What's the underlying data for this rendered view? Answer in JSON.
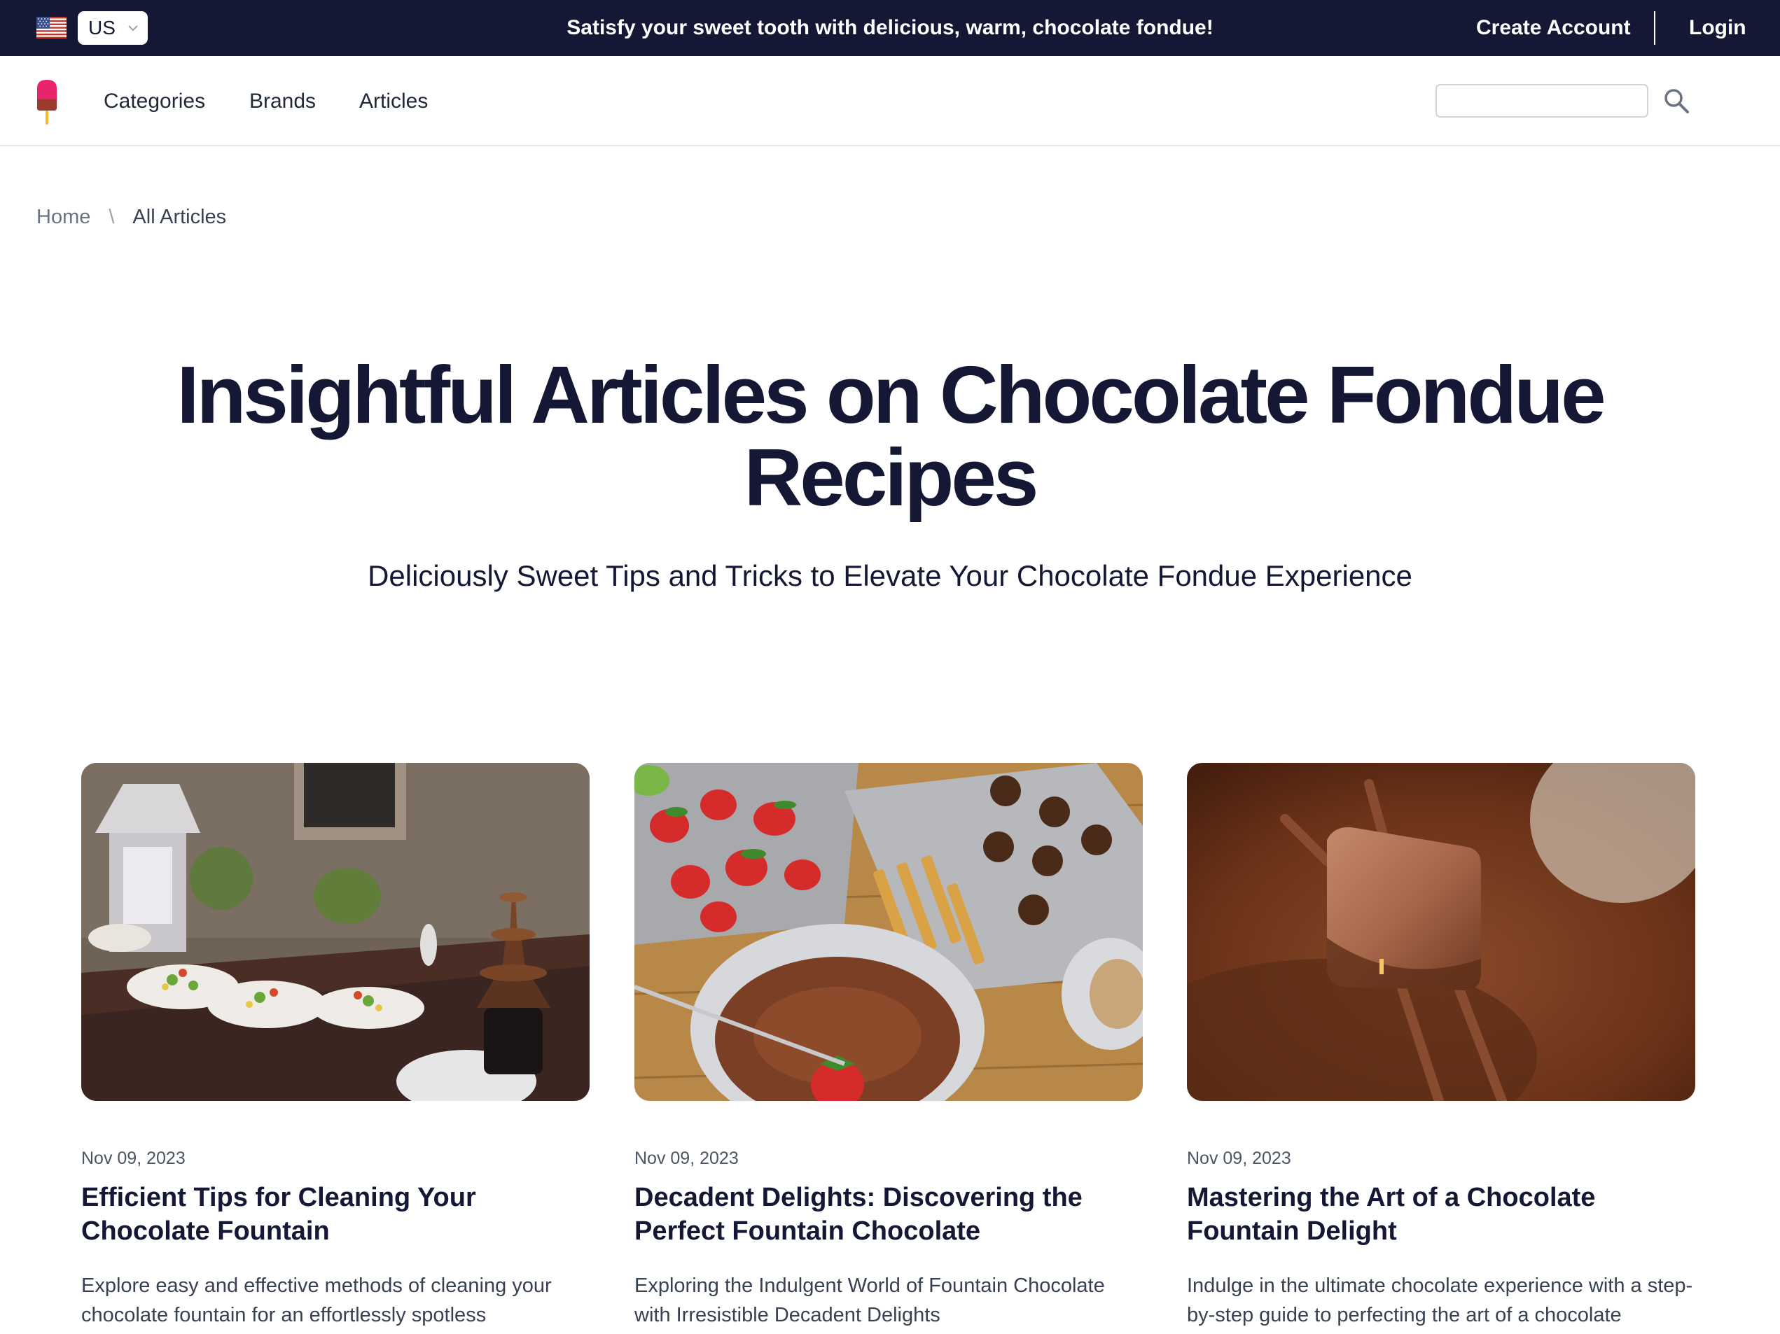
{
  "topbar": {
    "country": "US",
    "promo": "Satisfy your sweet tooth with delicious, warm, chocolate fondue!",
    "create_account": "Create Account",
    "login": "Login"
  },
  "nav": {
    "items": [
      {
        "label": "Categories"
      },
      {
        "label": "Brands"
      },
      {
        "label": "Articles"
      }
    ],
    "search_placeholder": ""
  },
  "breadcrumb": {
    "home": "Home",
    "separator": "\\",
    "current": "All Articles"
  },
  "hero": {
    "title_line1": "Insightful Articles on Chocolate Fondue",
    "title_line2": "Recipes",
    "subtitle": "Deliciously Sweet Tips and Tricks to Elevate Your Chocolate Fondue Experience"
  },
  "articles": [
    {
      "date": "Nov 09, 2023",
      "title": "Efficient Tips for Cleaning Your Chocolate Fountain",
      "excerpt": "Explore easy and effective methods of cleaning your chocolate fountain for an effortlessly spotless"
    },
    {
      "date": "Nov 09, 2023",
      "title": "Decadent Delights: Discovering the Perfect Fountain Chocolate",
      "excerpt": "Exploring the Indulgent World of Fountain Chocolate with Irresistible Decadent Delights"
    },
    {
      "date": "Nov 09, 2023",
      "title": "Mastering the Art of a Chocolate Fountain Delight",
      "excerpt": "Indulge in the ultimate chocolate experience with a step-by-step guide to perfecting the art of a chocolate"
    }
  ],
  "colors": {
    "topbar_bg": "#141834",
    "heading": "#141834",
    "border": "#e5e7eb"
  },
  "icons": {
    "flag": "us-flag-icon",
    "chevron": "chevron-down-icon",
    "logo": "popsicle-logo-icon",
    "search": "search-icon"
  }
}
